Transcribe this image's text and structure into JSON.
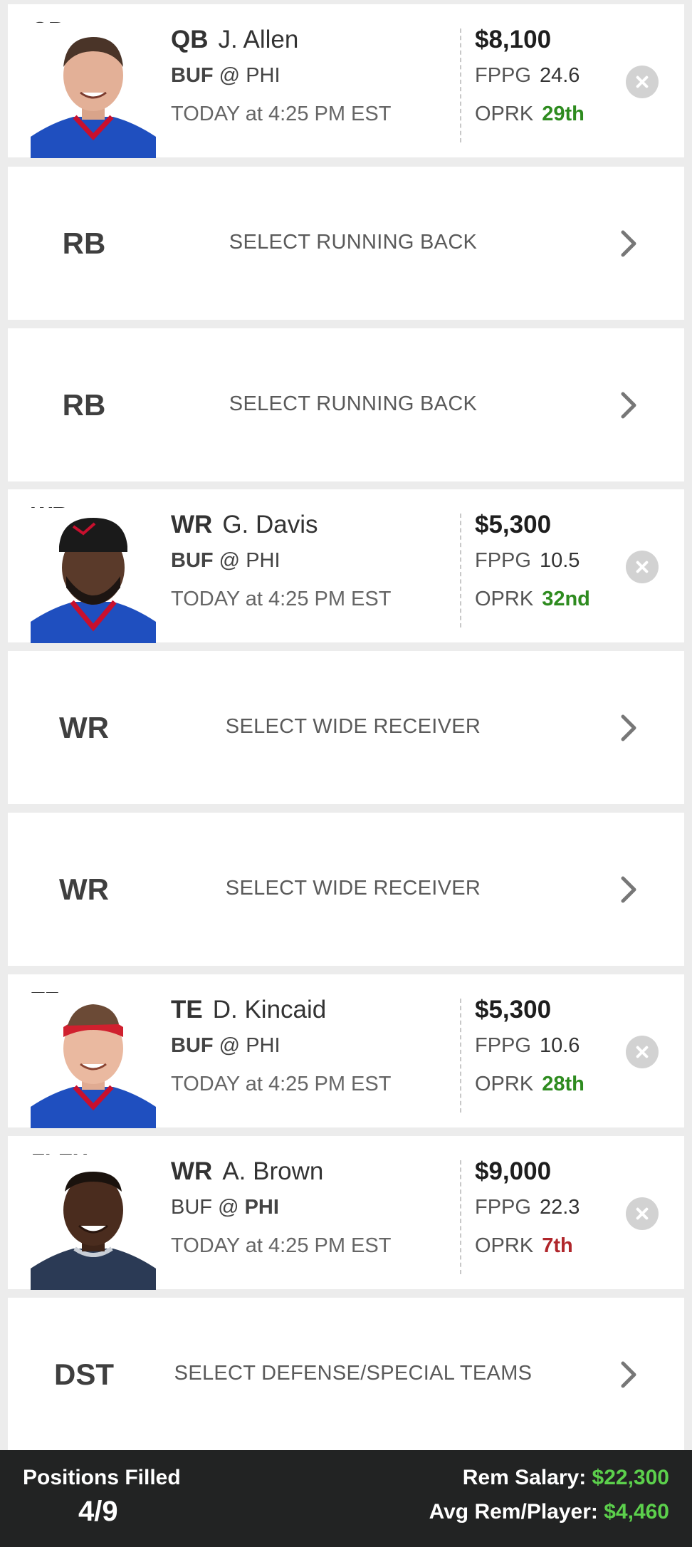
{
  "lineup": {
    "filled": [
      {
        "slot": "QB",
        "position": "QB",
        "name": "J. Allen",
        "away_team": "BUF",
        "home_team": "PHI",
        "at": "@",
        "bold_team": "away",
        "game_time": "TODAY at 4:25 PM EST",
        "salary": "$8,100",
        "fppg_label": "FPPG",
        "fppg": "24.6",
        "oprk_label": "OPRK",
        "oprk": "29th",
        "oprk_color": "#2e8b1f",
        "jersey_color": "#1f4fbf"
      },
      {
        "slot": "WR",
        "position": "WR",
        "name": "G. Davis",
        "away_team": "BUF",
        "home_team": "PHI",
        "at": "@",
        "bold_team": "away",
        "game_time": "TODAY at 4:25 PM EST",
        "salary": "$5,300",
        "fppg_label": "FPPG",
        "fppg": "10.5",
        "oprk_label": "OPRK",
        "oprk": "32nd",
        "oprk_color": "#2e8b1f",
        "jersey_color": "#1f4fbf"
      },
      {
        "slot": "TE",
        "position": "TE",
        "name": "D. Kincaid",
        "away_team": "BUF",
        "home_team": "PHI",
        "at": "@",
        "bold_team": "away",
        "game_time": "TODAY at 4:25 PM EST",
        "salary": "$5,300",
        "fppg_label": "FPPG",
        "fppg": "10.6",
        "oprk_label": "OPRK",
        "oprk": "28th",
        "oprk_color": "#2e8b1f",
        "jersey_color": "#1f4fbf"
      },
      {
        "slot": "FLEX",
        "position": "WR",
        "name": "A. Brown",
        "away_team": "BUF",
        "home_team": "PHI",
        "at": "@",
        "bold_team": "home",
        "game_time": "TODAY at 4:25 PM EST",
        "salary": "$9,000",
        "fppg_label": "FPPG",
        "fppg": "22.3",
        "oprk_label": "OPRK",
        "oprk": "7th",
        "oprk_color": "#b0262b",
        "jersey_color": "#2b3a55"
      }
    ],
    "empty": [
      {
        "slot": "RB",
        "label": "SELECT RUNNING BACK"
      },
      {
        "slot": "RB",
        "label": "SELECT RUNNING BACK"
      },
      {
        "slot": "WR",
        "label": "SELECT WIDE RECEIVER"
      },
      {
        "slot": "WR",
        "label": "SELECT WIDE RECEIVER"
      },
      {
        "slot": "DST",
        "label": "SELECT DEFENSE/SPECIAL TEAMS"
      }
    ],
    "icons": {
      "remove": "close-circle-icon",
      "select": "chevron-right-icon"
    }
  },
  "footer": {
    "positions_filled_label": "Positions Filled",
    "positions_filled_value": "4/9",
    "rem_salary_label": "Rem Salary:",
    "rem_salary_value": "$22,300",
    "avg_rem_label": "Avg Rem/Player:",
    "avg_rem_value": "$4,460",
    "money_color": "#5cd04c"
  }
}
